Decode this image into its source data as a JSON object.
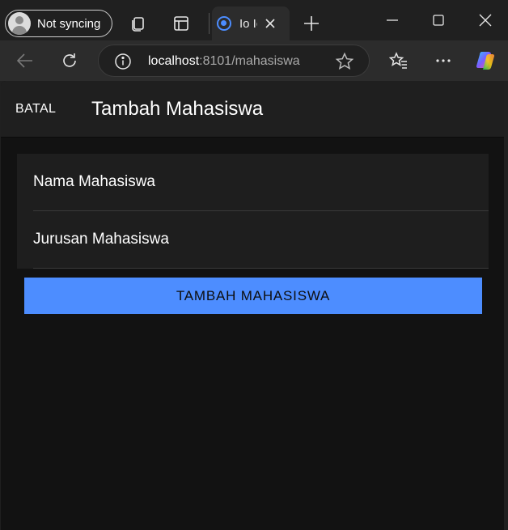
{
  "browser": {
    "profile": {
      "label": "Not syncing",
      "icon": "avatar-icon"
    },
    "tab": {
      "title": "Io Io",
      "favicon": "ionic-icon"
    },
    "address": {
      "host": "localhost",
      "path": ":8101/mahasiswa"
    }
  },
  "app": {
    "header": {
      "cancel_label": "BATAL",
      "title": "Tambah Mahasiswa"
    },
    "form": {
      "nama_placeholder": "Nama Mahasiswa",
      "jurusan_placeholder": "Jurusan Mahasiswa",
      "submit_label": "TAMBAH MAHASISWA"
    }
  },
  "colors": {
    "accent": "#4d8dff",
    "background": "#121212",
    "header": "#1f1f1f",
    "chrome": "#202020"
  }
}
